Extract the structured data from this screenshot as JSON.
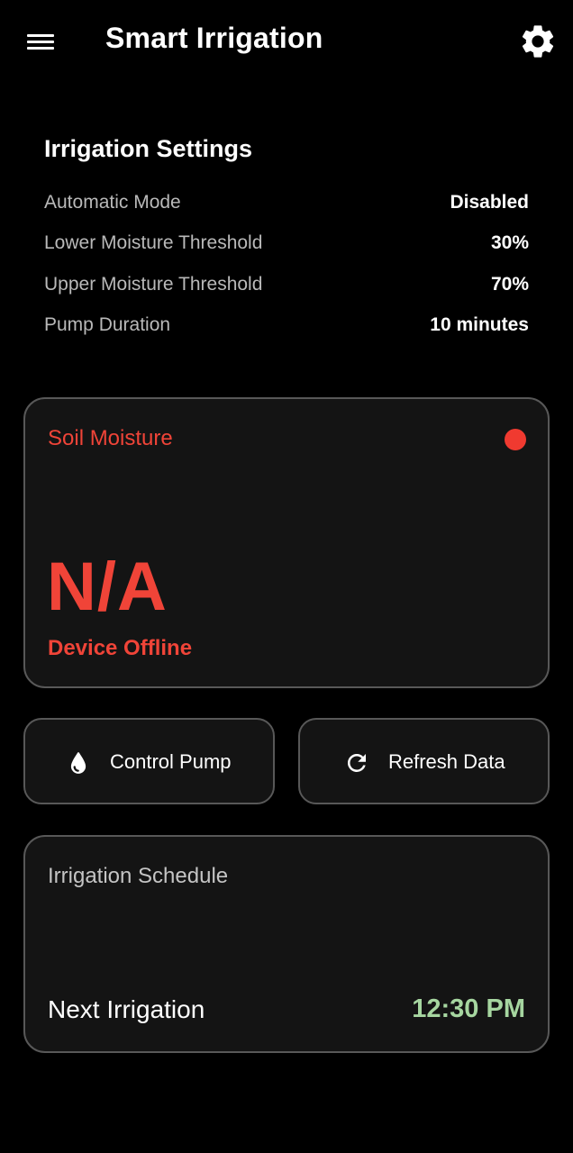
{
  "appbar": {
    "title": "Smart Irrigation",
    "menu_icon": "hamburger-menu-icon",
    "settings_icon": "gear-icon"
  },
  "settings": {
    "title": "Irrigation Settings",
    "rows": [
      {
        "label": "Automatic Mode",
        "value": "Disabled"
      },
      {
        "label": "Lower Moisture Threshold",
        "value": "30%"
      },
      {
        "label": "Upper Moisture Threshold",
        "value": "70%"
      },
      {
        "label": "Pump Duration",
        "value": "10 minutes"
      }
    ]
  },
  "moisture": {
    "title": "Soil Moisture",
    "value": "N/A",
    "status": "Device Offline",
    "status_color": "#f03a30"
  },
  "actions": {
    "pump": {
      "label": "Control Pump",
      "icon": "water-drop-icon"
    },
    "refresh": {
      "label": "Refresh Data",
      "icon": "refresh-icon"
    }
  },
  "schedule": {
    "title": "Irrigation Schedule",
    "next_label": "Next Irrigation",
    "next_time": "12:30 PM"
  },
  "colors": {
    "background": "#000000",
    "card": "#141414",
    "card_border": "#585858",
    "error": "#f04438",
    "success": "#a6d6a0"
  }
}
